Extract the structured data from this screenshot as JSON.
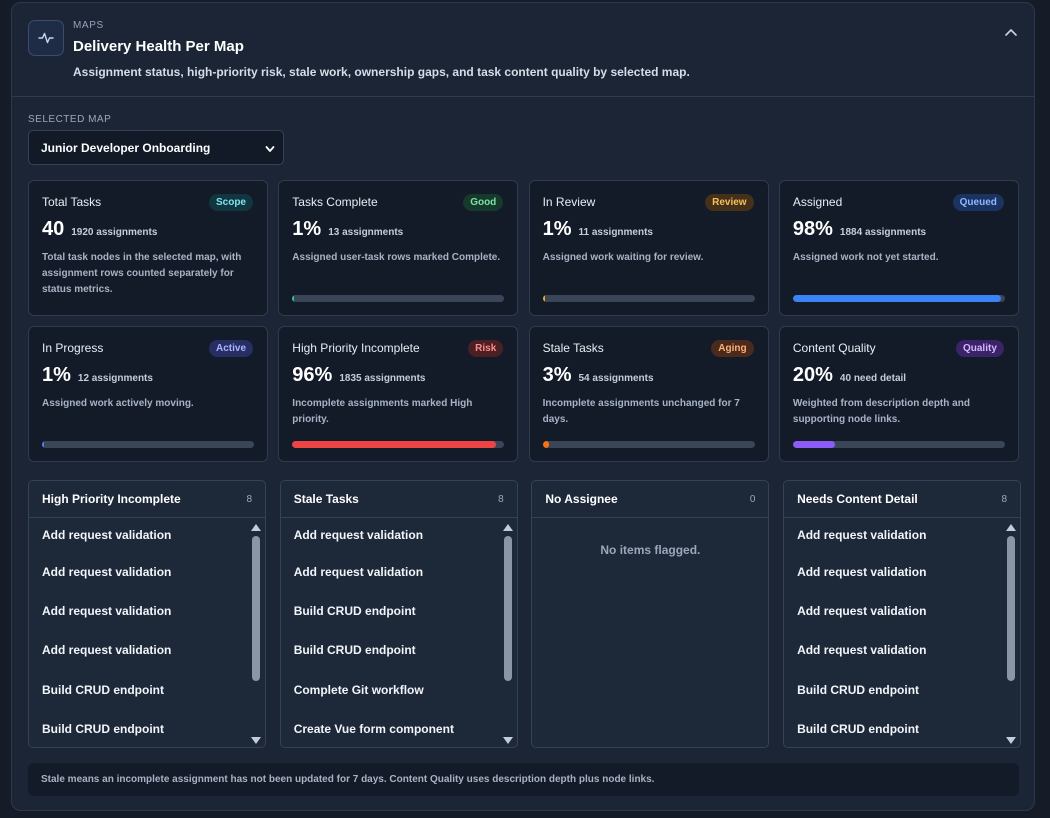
{
  "header": {
    "eyebrow": "MAPS",
    "title": "Delivery Health Per Map",
    "subtitle": "Assignment status, high-priority risk, stale work, ownership gaps, and task content quality by selected map.",
    "icon": "activity-icon",
    "collapse_icon": "chevron-up-icon"
  },
  "selector": {
    "label": "SELECTED MAP",
    "value": "Junior Developer Onboarding"
  },
  "metrics": [
    {
      "label": "Total Tasks",
      "badge": "Scope",
      "value": "40",
      "sub": "1920 assignments",
      "desc": "Total task nodes in the selected map, with assignment rows counted separately for status metrics.",
      "progress": null,
      "badge_bg": "#12363f",
      "badge_fg": "#7fe3ef",
      "color": null
    },
    {
      "label": "Tasks Complete",
      "badge": "Good",
      "value": "1%",
      "sub": "13 assignments",
      "desc": "Assigned user-task rows marked Complete.",
      "progress": 1,
      "badge_bg": "#153a2c",
      "badge_fg": "#7ee0a8",
      "color": "#2dbf8f"
    },
    {
      "label": "In Review",
      "badge": "Review",
      "value": "1%",
      "sub": "11 assignments",
      "desc": "Assigned work waiting for review.",
      "progress": 1,
      "badge_bg": "#45301a",
      "badge_fg": "#f7c15a",
      "color": "#f5a524"
    },
    {
      "label": "Assigned",
      "badge": "Queued",
      "value": "98%",
      "sub": "1884 assignments",
      "desc": "Assigned work not yet started.",
      "progress": 98,
      "badge_bg": "#1a3360",
      "badge_fg": "#8fb8ff",
      "color": "#3b82f6"
    },
    {
      "label": "In Progress",
      "badge": "Active",
      "value": "1%",
      "sub": "12 assignments",
      "desc": "Assigned work actively moving.",
      "progress": 1,
      "badge_bg": "#272e63",
      "badge_fg": "#aab4ff",
      "color": "#6574f0"
    },
    {
      "label": "High Priority Incomplete",
      "badge": "Risk",
      "value": "96%",
      "sub": "1835 assignments",
      "desc": "Incomplete assignments marked High priority.",
      "progress": 96,
      "badge_bg": "#4a2025",
      "badge_fg": "#ff8c8c",
      "color": "#ef4444"
    },
    {
      "label": "Stale Tasks",
      "badge": "Aging",
      "value": "3%",
      "sub": "54 assignments",
      "desc": "Incomplete assignments unchanged for 7 days.",
      "progress": 3,
      "badge_bg": "#4a2a1c",
      "badge_fg": "#ffae73",
      "color": "#f97316"
    },
    {
      "label": "Content Quality",
      "badge": "Quality",
      "value": "20%",
      "sub": "40 need detail",
      "desc": "Weighted from description depth and supporting node links.",
      "progress": 20,
      "badge_bg": "#3a2366",
      "badge_fg": "#d2b6ff",
      "color": "#8b5cf6"
    }
  ],
  "lists": [
    {
      "title": "High Priority Incomplete",
      "count": "8",
      "empty_text": "",
      "items": [
        "Add request validation",
        "Add request validation",
        "Add request validation",
        "Add request validation",
        "Build CRUD endpoint",
        "Build CRUD endpoint"
      ]
    },
    {
      "title": "Stale Tasks",
      "count": "8",
      "empty_text": "",
      "items": [
        "Add request validation",
        "Add request validation",
        "Build CRUD endpoint",
        "Build CRUD endpoint",
        "Complete Git workflow",
        "Create Vue form component"
      ]
    },
    {
      "title": "No Assignee",
      "count": "0",
      "empty_text": "No items flagged.",
      "items": []
    },
    {
      "title": "Needs Content Detail",
      "count": "8",
      "empty_text": "",
      "items": [
        "Add request validation",
        "Add request validation",
        "Add request validation",
        "Add request validation",
        "Build CRUD endpoint",
        "Build CRUD endpoint"
      ]
    }
  ],
  "footnote": "Stale means an incomplete assignment has not been updated for 7 days. Content Quality uses description depth plus node links."
}
